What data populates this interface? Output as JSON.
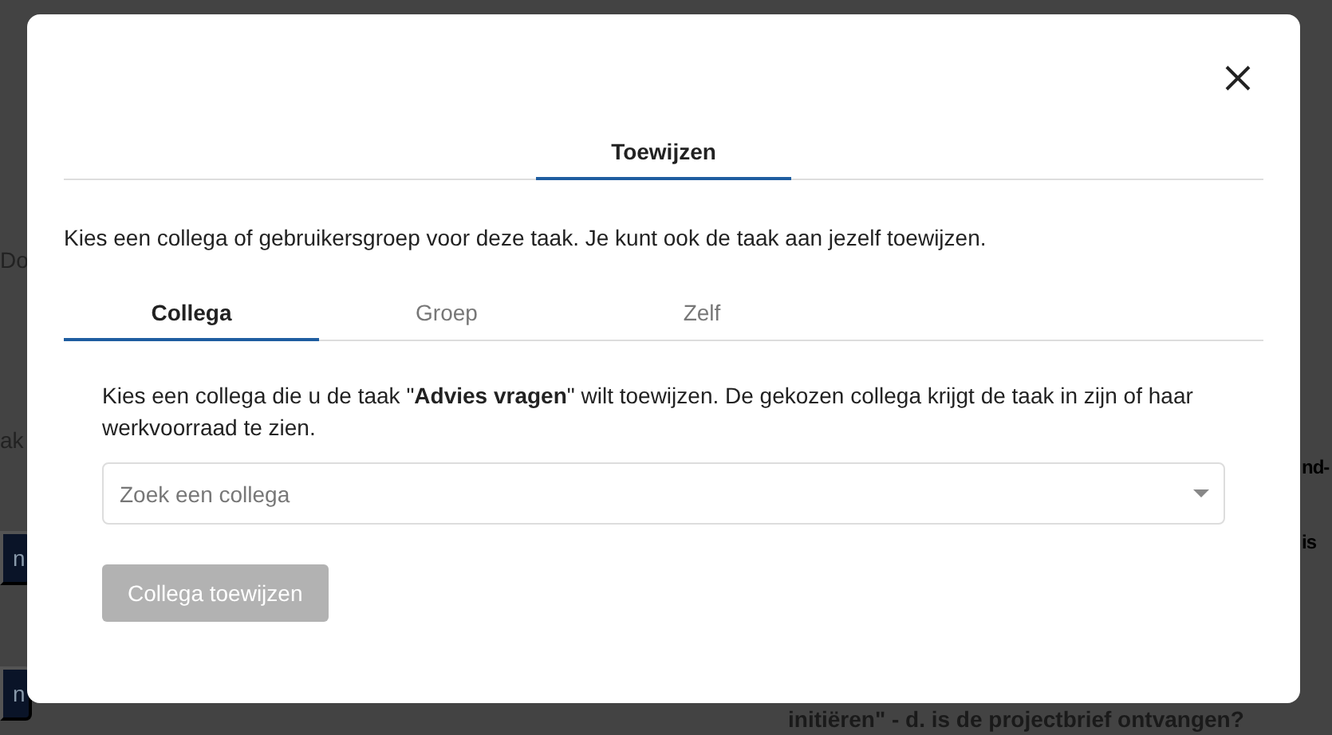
{
  "background": {
    "left_texts": [
      "Do",
      "ak"
    ],
    "left_buttons": [
      "n",
      "n"
    ],
    "right_texts": [
      "nd-",
      "is"
    ],
    "bottom_text": "initiëren\" - d. is de projectbrief ontvangen?"
  },
  "dialog": {
    "header_tabs": [
      {
        "label": "Toewijzen",
        "selected": true
      }
    ],
    "intro": "Kies een collega of gebruikersgroep voor deze taak. Je kunt ook de taak aan jezelf toewijzen.",
    "tabs": [
      {
        "label": "Collega",
        "selected": true
      },
      {
        "label": "Groep",
        "selected": false
      },
      {
        "label": "Zelf",
        "selected": false
      }
    ],
    "description": "Kies een collega die u de taak \"**Advies vragen**\" wilt toewijzen. De gekozen collega krijgt de taak in zijn of haar werkvoorraad te zien.",
    "select": {
      "placeholder": "Zoek een collega"
    },
    "assign_button": {
      "label": "Collega toewijzen",
      "disabled": true
    }
  }
}
